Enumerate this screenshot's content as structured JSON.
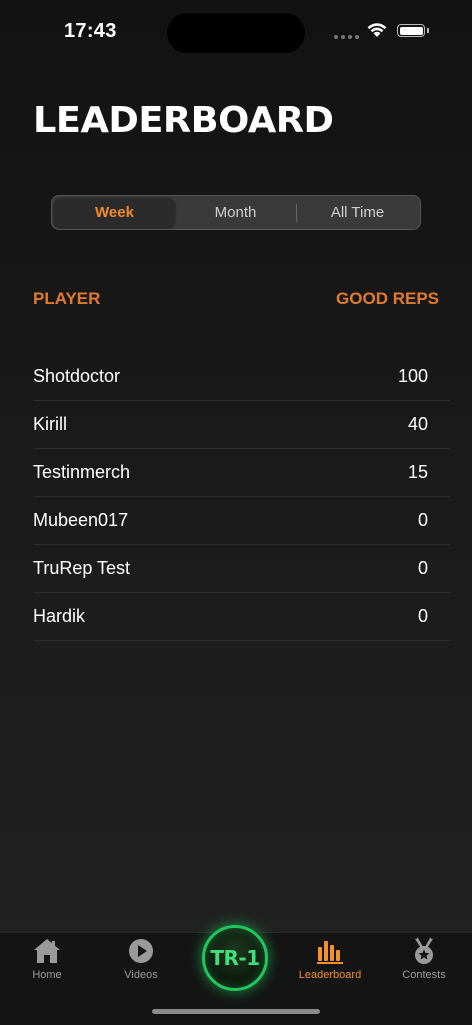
{
  "status": {
    "time": "17:43"
  },
  "page": {
    "title": "LEADERBOARD"
  },
  "segments": [
    {
      "label": "Week",
      "active": true
    },
    {
      "label": "Month",
      "active": false
    },
    {
      "label": "All Time",
      "active": false
    }
  ],
  "table": {
    "headers": {
      "player": "PLAYER",
      "score": "GOOD REPS"
    },
    "rows": [
      {
        "player": "Shotdoctor",
        "score": "100"
      },
      {
        "player": "Kirill",
        "score": "40"
      },
      {
        "player": "Testinmerch",
        "score": "15"
      },
      {
        "player": "Mubeen017",
        "score": "0"
      },
      {
        "player": "TruRep Test",
        "score": "0"
      },
      {
        "player": "Hardik",
        "score": "0"
      }
    ]
  },
  "tabbar": {
    "home": "Home",
    "videos": "Videos",
    "center": "TR-1",
    "leaderboard": "Leaderboard",
    "contests": "Contests"
  },
  "colors": {
    "accent": "#f08a2e",
    "center_glow": "#22c55e"
  },
  "icons": [
    "wifi-icon",
    "battery-icon",
    "home-icon",
    "play-icon",
    "bar-chart-icon",
    "medal-icon"
  ]
}
